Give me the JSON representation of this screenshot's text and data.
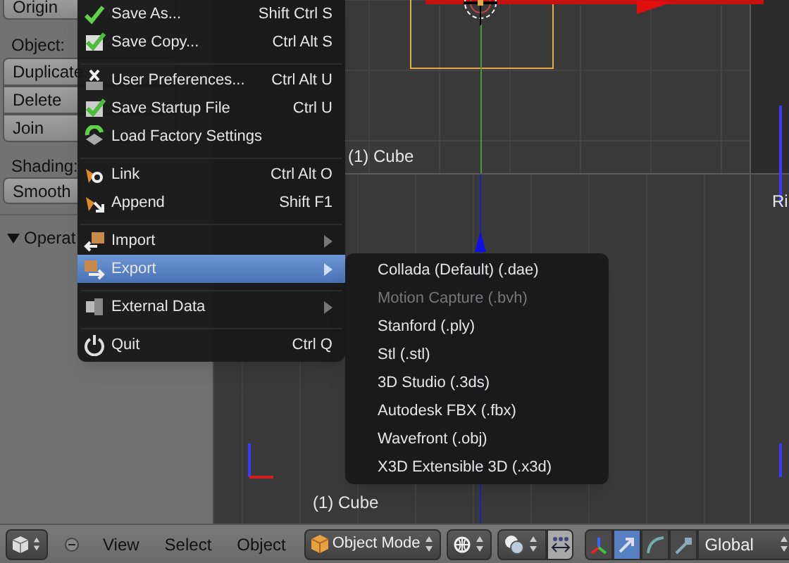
{
  "tool_panel": {
    "origin_button": "Origin",
    "object_label": "Object:",
    "object_buttons": [
      "Duplicate",
      "Delete",
      "Join"
    ],
    "shading_label": "Shading:",
    "shading_buttons": [
      "Smooth"
    ]
  },
  "operator_panel": {
    "title": "Operat",
    "expanded": true
  },
  "viewport": {
    "top_view_label": "(1) Cube",
    "side_view_label": "Ri",
    "bottom_view_label": "(1) Cube"
  },
  "file_menu": {
    "items": [
      {
        "label": "Save As...",
        "shortcut": "Shift Ctrl S",
        "kind": "command",
        "separator_before": false,
        "selected": false
      },
      {
        "label": "Save Copy...",
        "shortcut": "Ctrl Alt S",
        "kind": "command",
        "separator_before": false,
        "selected": false
      },
      {
        "label": "User Preferences...",
        "shortcut": "Ctrl Alt U",
        "kind": "command",
        "separator_before": true,
        "selected": false
      },
      {
        "label": "Save Startup File",
        "shortcut": "Ctrl U",
        "kind": "command",
        "separator_before": false,
        "selected": false
      },
      {
        "label": "Load Factory Settings",
        "kind": "command",
        "separator_before": false,
        "selected": false
      },
      {
        "label": "Link",
        "shortcut": "Ctrl Alt O",
        "kind": "command",
        "separator_before": true,
        "selected": false
      },
      {
        "label": "Append",
        "shortcut": "Shift F1",
        "kind": "command",
        "separator_before": false,
        "selected": false
      },
      {
        "label": "Import",
        "kind": "submenu",
        "separator_before": true,
        "selected": false
      },
      {
        "label": "Export",
        "kind": "submenu",
        "separator_before": false,
        "selected": true
      },
      {
        "label": "External Data",
        "kind": "submenu",
        "separator_before": true,
        "selected": false
      },
      {
        "label": "Quit",
        "shortcut": "Ctrl Q",
        "kind": "command",
        "separator_before": true,
        "selected": false
      }
    ]
  },
  "export_submenu": {
    "items": [
      {
        "label": "Collada (Default) (.dae)",
        "disabled": false
      },
      {
        "label": "Motion Capture (.bvh)",
        "disabled": true
      },
      {
        "label": "Stanford (.ply)",
        "disabled": false
      },
      {
        "label": "Stl (.stl)",
        "disabled": false
      },
      {
        "label": "3D Studio (.3ds)",
        "disabled": false
      },
      {
        "label": "Autodesk FBX (.fbx)",
        "disabled": false
      },
      {
        "label": "Wavefront (.obj)",
        "disabled": false
      },
      {
        "label": "X3D Extensible 3D (.x3d)",
        "disabled": false
      }
    ]
  },
  "header": {
    "menus": [
      "View",
      "Select",
      "Object"
    ],
    "mode": "Object Mode",
    "snap_on": true,
    "manipulators": [
      {
        "selected": false
      },
      {
        "selected": true
      },
      {
        "selected": false
      },
      {
        "selected": false
      }
    ],
    "orientation": "Global"
  }
}
